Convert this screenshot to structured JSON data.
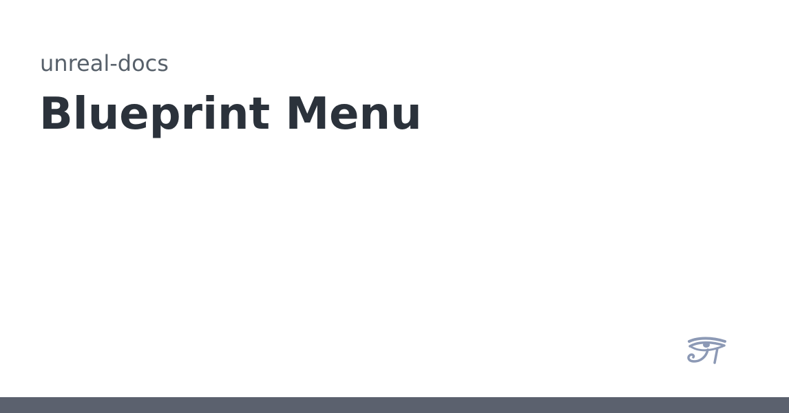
{
  "card": {
    "repo_name": "unreal-docs",
    "title": "Blueprint Menu"
  },
  "logo": {
    "icon": "eye-of-horus-icon",
    "color": "#8c99b5"
  },
  "colors": {
    "ink": "#2b323b",
    "muted": "#57606a",
    "bar": "#5b616e",
    "background": "#ffffff"
  }
}
